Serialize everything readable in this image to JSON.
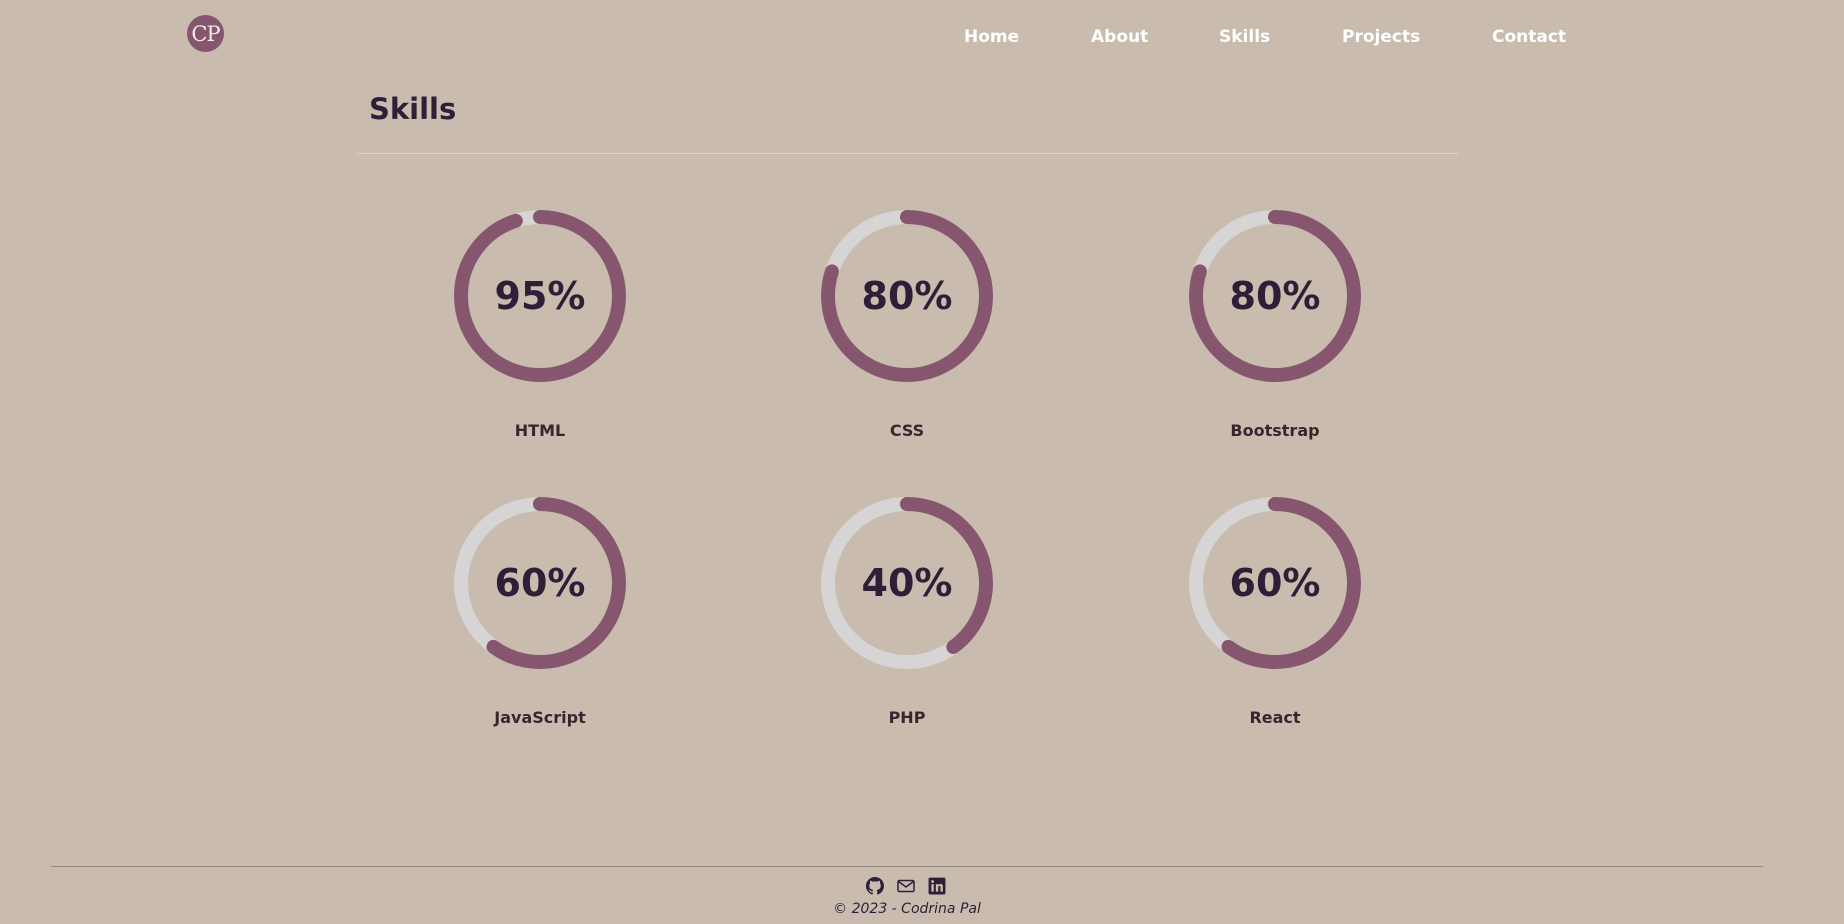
{
  "header": {
    "logo_text": "CP",
    "nav": [
      "Home",
      "About",
      "Skills",
      "Projects",
      "Contact"
    ]
  },
  "section": {
    "title": "Skills"
  },
  "skills": [
    {
      "name": "HTML",
      "percent_label": "95%",
      "value": 95
    },
    {
      "name": "CSS",
      "percent_label": "80%",
      "value": 80
    },
    {
      "name": "Bootstrap",
      "percent_label": "80%",
      "value": 80
    },
    {
      "name": "JavaScript",
      "percent_label": "60%",
      "value": 60
    },
    {
      "name": "PHP",
      "percent_label": "40%",
      "value": 40
    },
    {
      "name": "React",
      "percent_label": "60%",
      "value": 60
    }
  ],
  "footer": {
    "icons": [
      "github-icon",
      "mail-icon",
      "linkedin-icon"
    ],
    "copyright": "© 2023 - Codrina Pal"
  },
  "colors": {
    "background": "#c9bcaf",
    "accent": "#86566f",
    "track": "#d6d4d4",
    "text_dark": "#2e1e38",
    "nav_text": "#ffffff"
  }
}
